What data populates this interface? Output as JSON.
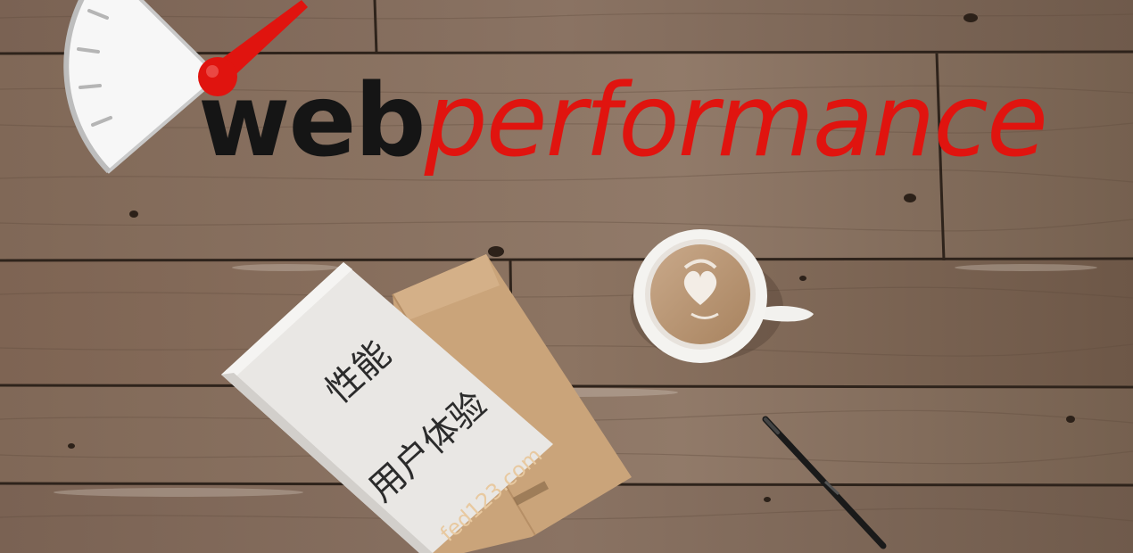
{
  "logo": {
    "word_dark": "web",
    "word_red": "performance"
  },
  "note_card": {
    "line1": "性能",
    "line2": "用户体验",
    "watermark": "fed123.com"
  },
  "colors": {
    "wood": "#7b6656",
    "brand_red": "#e0140f",
    "logo_dark": "#151515"
  },
  "icons": {
    "gauge": "speedometer-gauge-icon"
  }
}
